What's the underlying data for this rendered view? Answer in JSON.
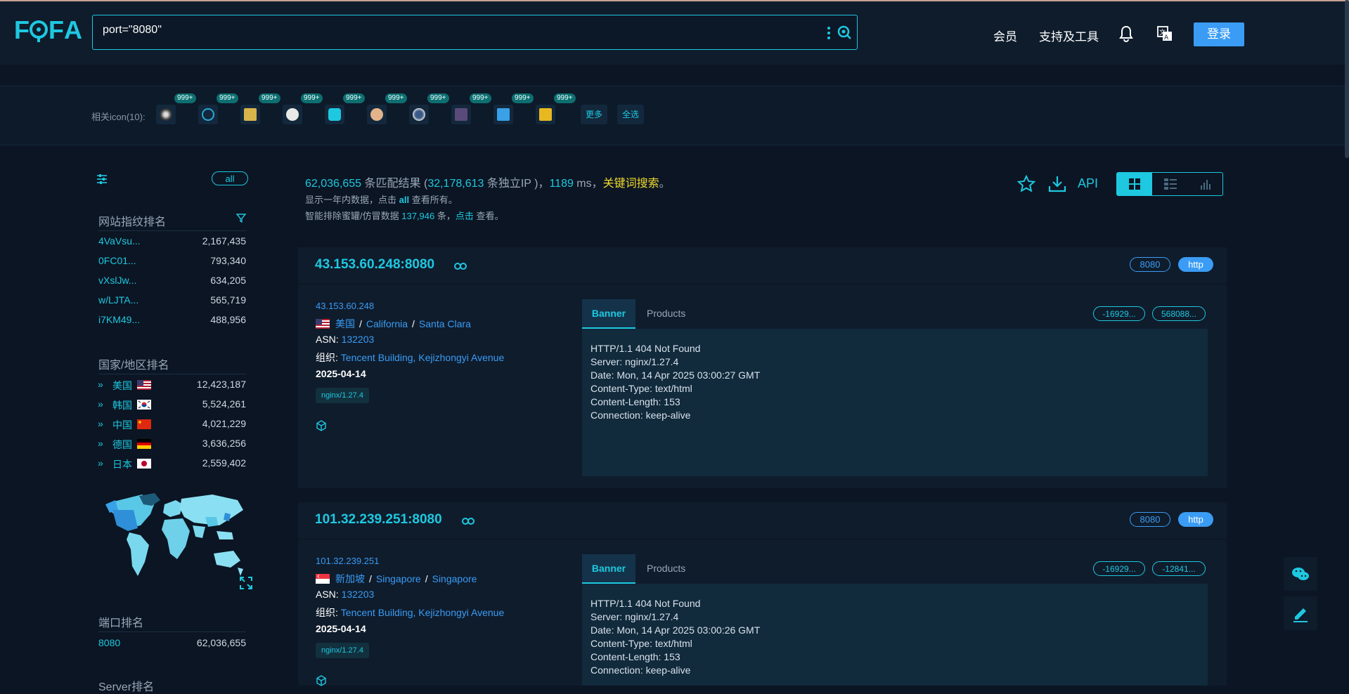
{
  "header": {
    "logo": "FOFA",
    "search_value": "port=\"8080\"",
    "nav": [
      "会员",
      "支持及工具"
    ],
    "login_label": "登录"
  },
  "icon_strip": {
    "label": "相关icon(10):",
    "badge": "999+",
    "icon_count": 10,
    "more_label": "更多",
    "select_all_label": "全选"
  },
  "sidebar": {
    "all_label": "all",
    "fingerprint_title": "网站指纹排名",
    "fingerprints": [
      {
        "name": "4VaVsu...",
        "count": "2,167,435"
      },
      {
        "name": "0FC01...",
        "count": "793,340"
      },
      {
        "name": "vXslJw...",
        "count": "634,205"
      },
      {
        "name": "w/LJTA...",
        "count": "565,719"
      },
      {
        "name": "i7KM49...",
        "count": "488,956"
      }
    ],
    "country_title": "国家/地区排名",
    "countries": [
      {
        "name": "美国",
        "count": "12,423,187",
        "flag": "us"
      },
      {
        "name": "韩国",
        "count": "5,524,261",
        "flag": "kr"
      },
      {
        "name": "中国",
        "count": "4,021,229",
        "flag": "cn"
      },
      {
        "name": "德国",
        "count": "3,636,256",
        "flag": "de"
      },
      {
        "name": "日本",
        "count": "2,559,402",
        "flag": "jp"
      }
    ],
    "port_title": "端口排名",
    "ports": [
      {
        "name": "8080",
        "count": "62,036,655"
      }
    ],
    "server_title": "Server排名"
  },
  "results": {
    "total": "62,036,655",
    "total_suffix": " 条匹配结果 (",
    "unique_ip": "32,178,613",
    "unique_suffix": " 条独立IP )，",
    "ms": "1189",
    "ms_suffix": " ms，",
    "keyword_search": "关键词搜索",
    "period": "。",
    "line2_prefix": "显示一年内数据，点击 ",
    "line2_all": "all",
    "line2_suffix": " 查看所有。",
    "line3_prefix": "智能排除蜜罐/仿冒数据 ",
    "line3_count": "137,946",
    "line3_mid": " 条，",
    "line3_click": "点击",
    "line3_suffix": " 查看。",
    "api_label": "API"
  },
  "cards": [
    {
      "host": "43.153.60.248:8080",
      "port": "8080",
      "protocol": "http",
      "ip": "43.153.60.248",
      "country": "美国",
      "region": "California",
      "city": "Santa Clara",
      "flag": "us",
      "asn_label": "ASN: ",
      "asn": "132203",
      "org_label": "组织: ",
      "org": "Tencent Building, Kejizhongyi Avenue",
      "date": "2025-04-14",
      "tag": "nginx/1.27.4",
      "tab_banner": "Banner",
      "tab_products": "Products",
      "hash1": "-16929...",
      "hash2": "568088...",
      "banner": [
        "HTTP/1.1 404 Not Found",
        "Server: nginx/1.27.4",
        "Date: Mon, 14 Apr 2025 03:00:27 GMT",
        "Content-Type: text/html",
        "Content-Length: 153",
        "Connection: keep-alive"
      ]
    },
    {
      "host": "101.32.239.251:8080",
      "port": "8080",
      "protocol": "http",
      "ip": "101.32.239.251",
      "country": "新加坡",
      "region": "Singapore",
      "city": "Singapore",
      "flag": "sg",
      "asn_label": "ASN: ",
      "asn": "132203",
      "org_label": "组织: ",
      "org": "Tencent Building, Kejizhongyi Avenue",
      "date": "2025-04-14",
      "tag": "nginx/1.27.4",
      "tab_banner": "Banner",
      "tab_products": "Products",
      "hash1": "-16929...",
      "hash2": "-12841...",
      "banner": [
        "HTTP/1.1 404 Not Found",
        "Server: nginx/1.27.4",
        "Date: Mon, 14 Apr 2025 03:00:26 GMT",
        "Content-Type: text/html",
        "Content-Length: 153",
        "Connection: keep-alive"
      ]
    }
  ],
  "colors": {
    "accent": "#1ec8e0",
    "link": "#3a9cf4",
    "highlight": "#f0d92e",
    "background": "#0b1523"
  }
}
